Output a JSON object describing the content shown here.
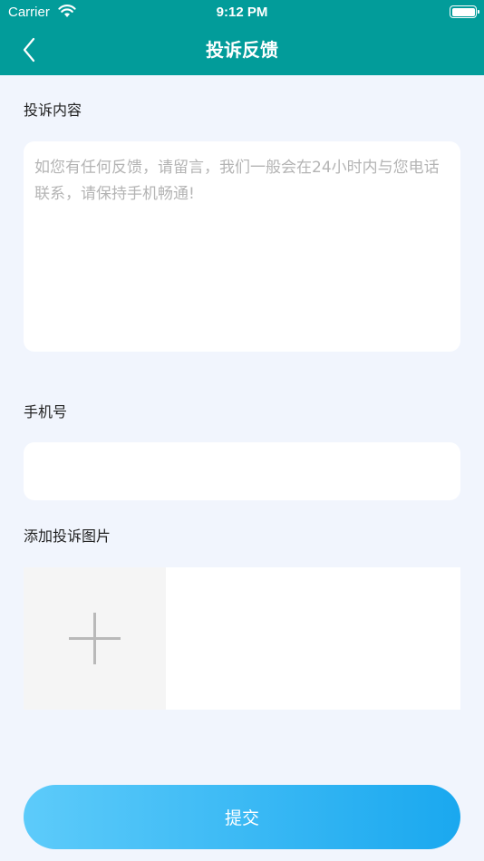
{
  "status_bar": {
    "carrier": "Carrier",
    "time": "9:12 PM"
  },
  "nav": {
    "title": "投诉反馈",
    "back_icon": "chevron-left-icon"
  },
  "form": {
    "content_label": "投诉内容",
    "content_placeholder": "如您有任何反馈，请留言，我们一般会在24小时内与您电话联系，请保持手机畅通!",
    "content_value": "",
    "phone_label": "手机号",
    "phone_placeholder": "",
    "phone_value": "",
    "image_label": "添加投诉图片",
    "add_image_icon": "plus-icon"
  },
  "submit_label": "提交",
  "colors": {
    "header_bg": "#029c9a",
    "page_bg": "#f1f5fd",
    "button_gradient_start": "#5dcbfa",
    "button_gradient_end": "#1aa8ef"
  }
}
